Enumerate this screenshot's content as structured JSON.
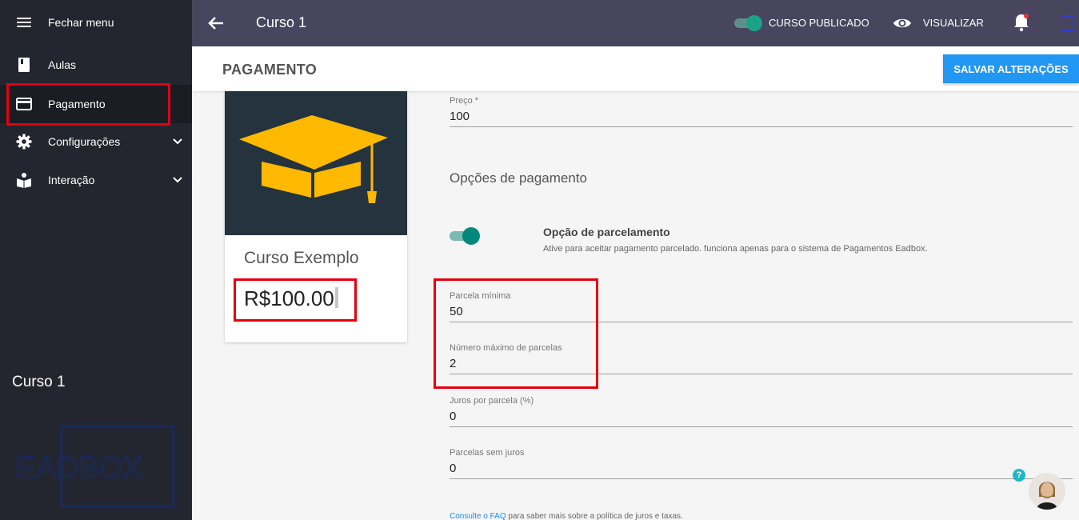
{
  "sidebar": {
    "menu_toggle": "Fechar menu",
    "items": [
      {
        "label": "Aulas",
        "icon": "book-icon"
      },
      {
        "label": "Pagamento",
        "icon": "credit-card-icon"
      },
      {
        "label": "Configurações",
        "icon": "gear-icon"
      },
      {
        "label": "Interação",
        "icon": "reader-icon"
      }
    ],
    "course_name": "Curso 1",
    "logo_text": "EADBOX"
  },
  "topbar": {
    "title": "Curso 1",
    "published_label": "CURSO PUBLICADO",
    "view_label": "VISUALIZAR"
  },
  "header": {
    "title": "PAGAMENTO",
    "save_label": "SALVAR ALTERAÇÕES"
  },
  "card": {
    "name": "Curso Exemplo",
    "price": "R$100.00"
  },
  "form": {
    "price": {
      "label": "Preço *",
      "value": "100"
    },
    "section_title": "Opções de pagamento",
    "installment_option": {
      "title": "Opção de parcelamento",
      "description": "Ative para aceitar pagamento parcelado. funciona apenas para o sistema de Pagamentos Eadbox."
    },
    "min_installment": {
      "label": "Parcela mínima",
      "value": "50"
    },
    "max_installments": {
      "label": "Número máximo de parcelas",
      "value": "2"
    },
    "interest": {
      "label": "Juros por parcela (%)",
      "value": "0"
    },
    "interest_free": {
      "label": "Parcelas sem juros",
      "value": "0"
    },
    "faq": {
      "link": "Consulte o FAQ",
      "rest": " para saber mais sobre a política de juros e taxas."
    }
  },
  "help": {
    "label": "?"
  },
  "colors": {
    "sidebar": "#23262f",
    "topbar": "#48465e",
    "accent": "#2196f3",
    "toggle": "#00897b",
    "highlight": "#e3000f",
    "card_image": "#24333d",
    "cap": "#ffb900"
  }
}
